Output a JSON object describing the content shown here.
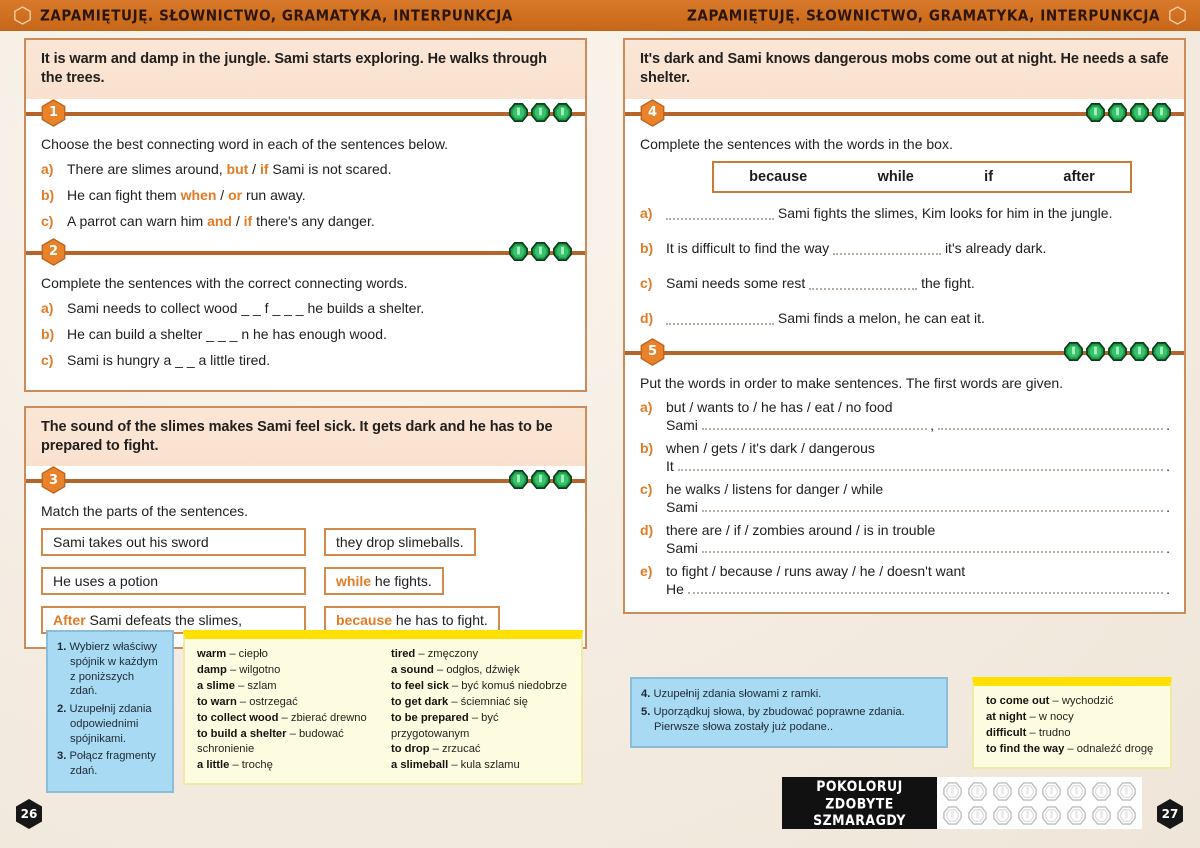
{
  "header": {
    "left_title": "ZAPAMIĘTUJĘ. SŁOWNICTWO, GRAMATYKA, INTERPUNKCJA",
    "right_title": "ZAPAMIĘTUJĘ. SŁOWNICTWO, GRAMATYKA, INTERPUNKCJA"
  },
  "left_page": {
    "page_number": "26",
    "panel1": {
      "intro": "It is warm and damp in the jungle. Sami starts exploring. He walks through the trees.",
      "ex1": {
        "number": "1",
        "gems": 3,
        "instruction": "Choose the best connecting word in each of the sentences below.",
        "items": [
          {
            "letter": "a)",
            "pre": "There are slimes around, ",
            "w1": "but",
            "sep": " / ",
            "w2": "if",
            "post": " Sami is not scared."
          },
          {
            "letter": "b)",
            "pre": "He can fight them ",
            "w1": "when",
            "sep": " / ",
            "w2": "or",
            "post": " run away."
          },
          {
            "letter": "c)",
            "pre": "A parrot can warn him ",
            "w1": "and",
            "sep": " / ",
            "w2": "if",
            "post": " there's any danger."
          }
        ]
      },
      "ex2": {
        "number": "2",
        "gems": 3,
        "instruction": "Complete the sentences with the correct connecting words.",
        "items": [
          {
            "letter": "a)",
            "text": "Sami needs to collect wood  _ _ f _ _ _  he builds a shelter."
          },
          {
            "letter": "b)",
            "text": "He can build a shelter  _ _ _ n  he has enough wood."
          },
          {
            "letter": "c)",
            "text": "Sami is hungry  a _ _  a little tired."
          }
        ]
      }
    },
    "panel2": {
      "intro": "The sound of the slimes makes Sami feel sick. It gets dark and he has to be prepared to fight.",
      "ex3": {
        "number": "3",
        "gems": 3,
        "instruction": "Match the parts of the sentences.",
        "left_parts": [
          {
            "hl": "",
            "text": "Sami takes out his sword"
          },
          {
            "hl": "",
            "text": "He uses a potion"
          },
          {
            "hl": "After",
            "text": " Sami defeats the slimes,"
          }
        ],
        "right_parts": [
          {
            "hl": "",
            "text": "they drop slimeballs."
          },
          {
            "hl": "while",
            "text": " he fights."
          },
          {
            "hl": "because",
            "text": " he has to fight."
          }
        ]
      }
    },
    "notes_pl": [
      {
        "num": "1.",
        "text": "Wybierz właściwy spójnik w każdym z poniższych zdań."
      },
      {
        "num": "2.",
        "text": "Uzupełnij zdania odpowiednimi spójnikami."
      },
      {
        "num": "3.",
        "text": "Połącz fragmenty zdań."
      }
    ],
    "vocab_col1": [
      {
        "en": "warm",
        "pl": "– ciepło"
      },
      {
        "en": "damp",
        "pl": "– wilgotno"
      },
      {
        "en": "a slime",
        "pl": "– szlam"
      },
      {
        "en": "to warn",
        "pl": "– ostrzegać"
      },
      {
        "en": "to collect wood",
        "pl": "– zbierać drewno"
      },
      {
        "en": "to build a shelter",
        "pl": "– budować schronienie"
      },
      {
        "en": "a little",
        "pl": "– trochę"
      }
    ],
    "vocab_col2": [
      {
        "en": "tired",
        "pl": "– zmęczony"
      },
      {
        "en": "a sound",
        "pl": "– odgłos, dźwięk"
      },
      {
        "en": "to feel sick",
        "pl": "– być komuś niedobrze"
      },
      {
        "en": "to get dark",
        "pl": "– ściemniać się"
      },
      {
        "en": "to be prepared",
        "pl": "– być przygotowanym"
      },
      {
        "en": "to drop",
        "pl": "– zrzucać"
      },
      {
        "en": "a slimeball",
        "pl": "– kula szlamu"
      }
    ]
  },
  "right_page": {
    "page_number": "27",
    "panel1": {
      "intro": "It's dark and Sami knows dangerous mobs come out at night. He needs a safe shelter.",
      "ex4": {
        "number": "4",
        "gems": 4,
        "instruction": "Complete the sentences with the words in the box.",
        "word_box": [
          "because",
          "while",
          "if",
          "after"
        ],
        "items": [
          {
            "letter": "a)",
            "pre": "",
            "blank": 1,
            "post": "Sami fights the slimes, Kim looks for him in the jungle."
          },
          {
            "letter": "b)",
            "pre": "It is difficult to find the way ",
            "blank": 1,
            "post": "it's already dark."
          },
          {
            "letter": "c)",
            "pre": "Sami needs some rest ",
            "blank": 1,
            "post": "the fight."
          },
          {
            "letter": "d)",
            "pre": "",
            "blank": 1,
            "post": "Sami finds a melon, he can eat it."
          }
        ]
      },
      "ex5": {
        "number": "5",
        "gems": 5,
        "instruction": "Put the words in order to make sentences. The first words are given.",
        "items": [
          {
            "letter": "a)",
            "prompt": "but / wants to / he has / eat / no food",
            "start": "Sami",
            "two_blanks": true
          },
          {
            "letter": "b)",
            "prompt": "when / gets / it's dark / dangerous",
            "start": "It",
            "two_blanks": false
          },
          {
            "letter": "c)",
            "prompt": "he walks / listens for danger / while",
            "start": "Sami",
            "two_blanks": false
          },
          {
            "letter": "d)",
            "prompt": "there are / if / zombies around / is in trouble",
            "start": "Sami",
            "two_blanks": false
          },
          {
            "letter": "e)",
            "prompt": "to fight / because / runs away / he / doesn't want",
            "start": "He",
            "two_blanks": false
          }
        ]
      }
    },
    "notes_pl": [
      {
        "num": "4.",
        "text": "Uzupełnij zdania słowami  z ramki."
      },
      {
        "num": "5.",
        "text": "Uporządkuj słowa, by zbudować poprawne zdania. Pierwsze słowa zostały już podane.."
      }
    ],
    "vocab_col1": [
      {
        "en": "to come out",
        "pl": "– wychodzić"
      },
      {
        "en": "at night",
        "pl": "– w nocy"
      },
      {
        "en": "difficult",
        "pl": "– trudno"
      },
      {
        "en": "to find the way",
        "pl": "– odnaleźć drogę"
      }
    ]
  },
  "emerald_counter": {
    "label_line1": "POKOLORUJ ZDOBYTE",
    "label_line2": "SZMARAGDY",
    "slots": 16
  },
  "colors": {
    "header_orange": "#cf6f1f",
    "accent_orange": "#e07b26",
    "panel_border": "#c98c5a",
    "intro_bg": "#fbe6d6",
    "note_blue": "#a9daf4",
    "vocab_yellow": "#fdfbe0",
    "vocab_top": "#ffe000",
    "gem_green": "#22a04a"
  }
}
